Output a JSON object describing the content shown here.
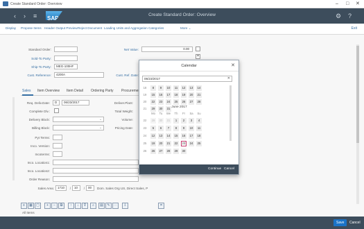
{
  "window": {
    "title": "Create Standard Order: Overview",
    "min_glyph": "–",
    "max_glyph": "□",
    "close_glyph": "✕"
  },
  "shell": {
    "logo": "SAP",
    "title": "Create Standard Order: Overview",
    "back_glyph": "‹",
    "menu_glyph": "≡"
  },
  "toolbar": {
    "items": [
      "Display",
      "Propose Items",
      "Header Output Preview",
      "Reject Document",
      "Loading Units and Aggregation Categories",
      "More ⌄"
    ],
    "exit_label": "Exit"
  },
  "header": {
    "standard_order_label": "Standard Order:",
    "sold_to_party_label": "Sold-To Party:",
    "ship_to_party_label": "Ship-To Party:",
    "ship_to_party_value": "MEG-100HF",
    "cust_reference_label": "Cust. Reference:",
    "cust_reference_value": "4200A",
    "net_value_label": "Net Value:",
    "net_value": "0.00",
    "cust_ref_date_label": "Cust. Ref. Date:"
  },
  "tabs": [
    "Sales",
    "Item Overview",
    "Item Detail",
    "Ordering Party",
    "Procurement"
  ],
  "sales_tab": {
    "labels": [
      "Req. Deliv.Date:",
      "Complete Dlv.:",
      "Delivery Block:",
      "Billing Block:",
      "Pyt Terms:",
      "Inco. Version:",
      "Incoterms:",
      "Inco. Location1:",
      "Inco. Location2:",
      "Order Reason:"
    ],
    "req_deliv_prefix": "D",
    "req_deliv_date": "06/23/2017",
    "right_labels": [
      "Deliver.Plant:",
      "Total Weight:",
      "Volume:",
      "Pricing Date:"
    ],
    "sales_area_label": "Sales Area:",
    "sales_area_1": "1710",
    "sales_area_2": "10",
    "sales_area_3": "00",
    "sales_area_text": "Dom. Sales Org US, Direct Sales, P"
  },
  "items_label": "All Items",
  "bottom": {
    "save_label": "Save",
    "cancel_label": "Cancel"
  },
  "calendar": {
    "title": "Calendar",
    "close_glyph": "✕",
    "date_value": "06/23/2017",
    "clear_glyph": "✕",
    "day_headers": [
      "Mo",
      "Tu",
      "We",
      "Th",
      "Fr",
      "Sa",
      "Su"
    ],
    "month_label": "June 2017",
    "selected_day": "23",
    "continue_label": "Continue",
    "cancel_label": "Cancel",
    "upper_rows": [
      {
        "week": "18",
        "days": [
          "8",
          "9",
          "10",
          "11",
          "12",
          "13",
          "14"
        ]
      },
      {
        "week": "19",
        "days": [
          "15",
          "16",
          "17",
          "18",
          "19",
          "20",
          "21"
        ]
      },
      {
        "week": "20",
        "days": [
          "22",
          "23",
          "24",
          "25",
          "26",
          "27",
          "28"
        ]
      },
      {
        "week": "21",
        "days": [
          "29",
          "30",
          "31",
          "",
          "",
          "",
          ""
        ]
      }
    ],
    "lower_rows": [
      {
        "week": "22",
        "days": [
          "29",
          "30",
          "31",
          "1",
          "2",
          "3",
          "4"
        ]
      },
      {
        "week": "23",
        "days": [
          "5",
          "6",
          "7",
          "8",
          "9",
          "10",
          "11"
        ]
      },
      {
        "week": "24",
        "days": [
          "12",
          "13",
          "14",
          "15",
          "16",
          "17",
          "18"
        ]
      },
      {
        "week": "25",
        "days": [
          "19",
          "20",
          "21",
          "22",
          "23",
          "24",
          "25"
        ]
      },
      {
        "week": "26",
        "days": [
          "26",
          "27",
          "28",
          "29",
          "30",
          "",
          ""
        ]
      }
    ]
  }
}
